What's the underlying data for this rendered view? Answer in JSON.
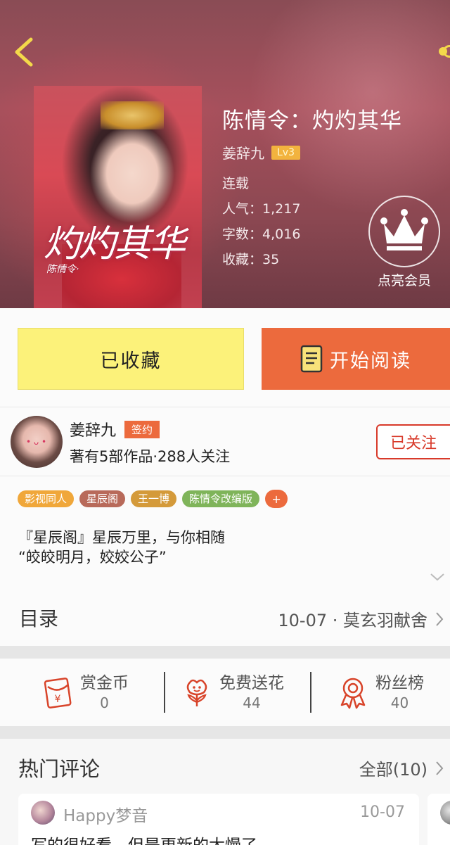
{
  "book": {
    "title": "陈情令：灼灼其华",
    "author": "姜辞九",
    "level": "Lv3",
    "status": "连载",
    "popularity_label": "人气：",
    "popularity": "1,217",
    "word_count_label": "字数：",
    "word_count": "4,016",
    "favorites_label": "收藏：",
    "favorites": "35",
    "cover_title": "灼灼其华",
    "cover_subtitle": "陈情令·"
  },
  "vip": {
    "label": "点亮会员"
  },
  "actions": {
    "collected_label": "已收藏",
    "read_label": "开始阅读"
  },
  "author_info": {
    "name": "姜辞九",
    "signed_badge": "签约",
    "stats": "著有5部作品·288人关注",
    "follow_label": "已关注"
  },
  "tags": [
    {
      "label": "影视同人",
      "color": "#f0a73a"
    },
    {
      "label": "星辰阁",
      "color": "#b86a5a"
    },
    {
      "label": "王一博",
      "color": "#d49a3a"
    },
    {
      "label": "陈情令改编版",
      "color": "#7fb45a"
    }
  ],
  "tag_more": "+",
  "description": {
    "line1": "『星辰阁』星辰万里，与你相随",
    "line2": "“皎皎明月，姣姣公子”"
  },
  "toc": {
    "label": "目录",
    "latest": "10-07 · 莫玄羽献舍"
  },
  "stats": [
    {
      "label": "赏金币",
      "value": "0",
      "icon": "red-envelope-icon"
    },
    {
      "label": "免费送花",
      "value": "44",
      "icon": "flower-icon"
    },
    {
      "label": "粉丝榜",
      "value": "40",
      "icon": "medal-icon"
    }
  ],
  "comments": {
    "title": "热门评论",
    "all_label": "全部(10)",
    "items": [
      {
        "user": "Happy梦音",
        "date": "10-07",
        "text": "写的很好看，但是更新的太慢了"
      }
    ]
  },
  "colors": {
    "accent_orange": "#ec6a3d",
    "collected_yellow": "#fcf27a",
    "level_badge": "#f2b33e"
  }
}
